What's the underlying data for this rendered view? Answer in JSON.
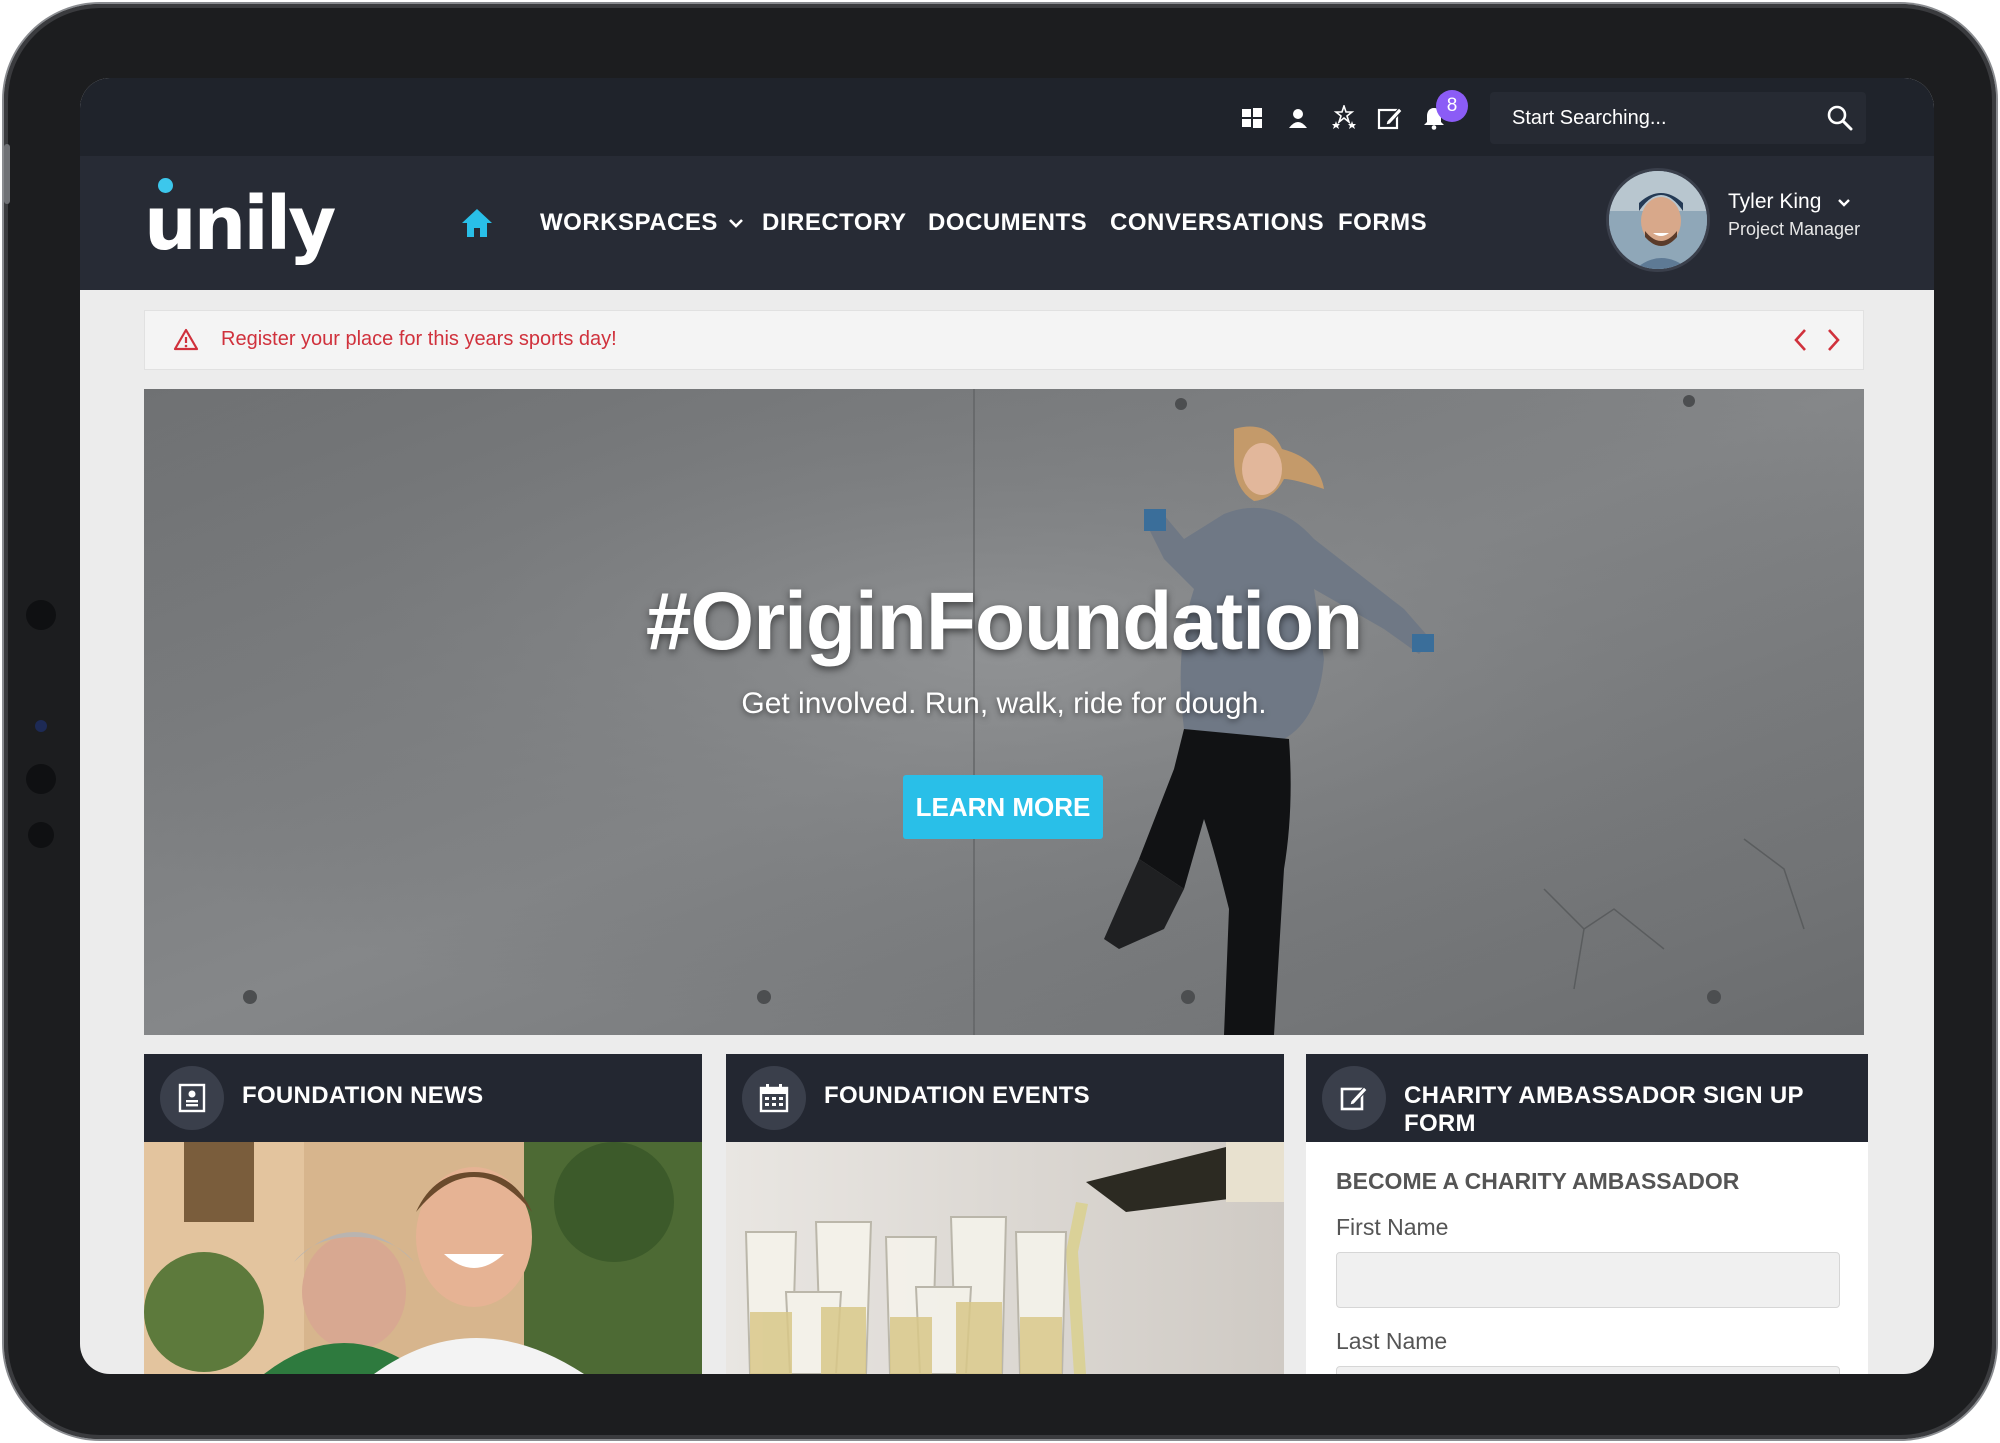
{
  "brand": {
    "logo_text": "unily",
    "accent_color": "#29bfe8",
    "header_color": "#272b35",
    "topbar_color": "#1f232b"
  },
  "topbar": {
    "icons": [
      "windows-icon",
      "user-icon",
      "stars-icon",
      "edit-icon",
      "bell-icon"
    ],
    "notification_count": "8",
    "search_placeholder": "Start Searching..."
  },
  "nav": {
    "home_icon": "home-icon",
    "items": [
      {
        "label": "WORKSPACES",
        "has_dropdown": true
      },
      {
        "label": "DIRECTORY"
      },
      {
        "label": "DOCUMENTS"
      },
      {
        "label": "CONVERSATIONS"
      },
      {
        "label": "FORMS"
      }
    ]
  },
  "user": {
    "name": "Tyler King",
    "role": "Project Manager"
  },
  "alert": {
    "text": "Register your place for this years sports day!",
    "color": "#d0313c"
  },
  "hero": {
    "title": "#OriginFoundation",
    "subtitle": "Get involved. Run, walk, ride for dough.",
    "button": "LEARN MORE"
  },
  "cards": [
    {
      "title": "FOUNDATION NEWS",
      "icon": "news-icon"
    },
    {
      "title": "FOUNDATION EVENTS",
      "icon": "calendar-icon"
    },
    {
      "title": "CHARITY AMBASSADOR SIGN UP FORM",
      "icon": "edit-icon"
    }
  ],
  "form": {
    "heading": "BECOME A CHARITY AMBASSADOR",
    "first_name_label": "First Name",
    "last_name_label": "Last Name"
  }
}
